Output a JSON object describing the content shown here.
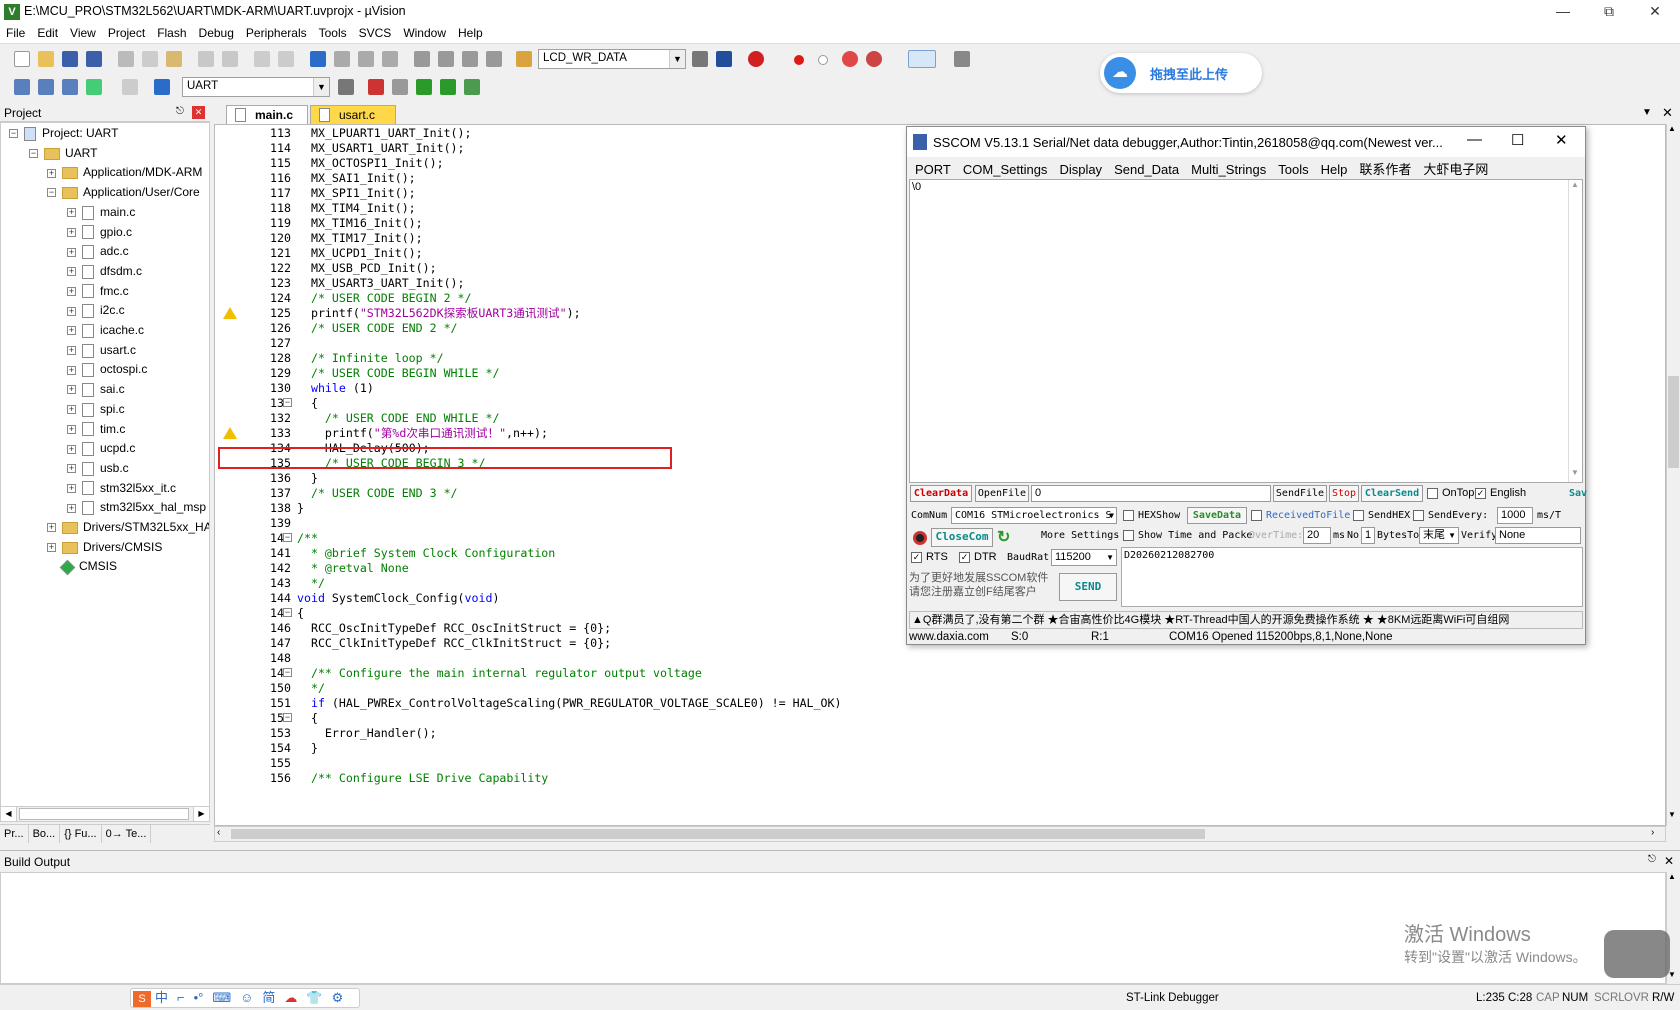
{
  "window": {
    "title": "E:\\MCU_PRO\\STM32L562\\UART\\MDK-ARM\\UART.uvprojx - µVision",
    "icon": "V"
  },
  "menu": [
    "File",
    "Edit",
    "View",
    "Project",
    "Flash",
    "Debug",
    "Peripherals",
    "Tools",
    "SVCS",
    "Window",
    "Help"
  ],
  "toolbar": {
    "function_combo": "LCD_WR_DATA",
    "target_combo": "UART"
  },
  "upload_badge": "拖拽至此上传",
  "project_panel": {
    "title": "Project",
    "items": [
      {
        "label": "Project: UART",
        "indent": 0,
        "type": "root"
      },
      {
        "label": "UART",
        "indent": 1,
        "type": "folder"
      },
      {
        "label": "Application/MDK-ARM",
        "indent": 2,
        "type": "folder"
      },
      {
        "label": "Application/User/Core",
        "indent": 2,
        "type": "folder"
      },
      {
        "label": "main.c",
        "indent": 3,
        "type": "file"
      },
      {
        "label": "gpio.c",
        "indent": 3,
        "type": "file"
      },
      {
        "label": "adc.c",
        "indent": 3,
        "type": "file"
      },
      {
        "label": "dfsdm.c",
        "indent": 3,
        "type": "file"
      },
      {
        "label": "fmc.c",
        "indent": 3,
        "type": "file"
      },
      {
        "label": "i2c.c",
        "indent": 3,
        "type": "file"
      },
      {
        "label": "icache.c",
        "indent": 3,
        "type": "file"
      },
      {
        "label": "usart.c",
        "indent": 3,
        "type": "file"
      },
      {
        "label": "octospi.c",
        "indent": 3,
        "type": "file"
      },
      {
        "label": "sai.c",
        "indent": 3,
        "type": "file"
      },
      {
        "label": "spi.c",
        "indent": 3,
        "type": "file"
      },
      {
        "label": "tim.c",
        "indent": 3,
        "type": "file"
      },
      {
        "label": "ucpd.c",
        "indent": 3,
        "type": "file"
      },
      {
        "label": "usb.c",
        "indent": 3,
        "type": "file"
      },
      {
        "label": "stm32l5xx_it.c",
        "indent": 3,
        "type": "file"
      },
      {
        "label": "stm32l5xx_hal_msp",
        "indent": 3,
        "type": "file"
      },
      {
        "label": "Drivers/STM32L5xx_HA",
        "indent": 2,
        "type": "folder"
      },
      {
        "label": "Drivers/CMSIS",
        "indent": 2,
        "type": "folder"
      },
      {
        "label": "CMSIS",
        "indent": 2,
        "type": "gem"
      }
    ],
    "bottom_tabs": [
      "Pr...",
      "Bo...",
      "{} Fu...",
      "0→ Te..."
    ]
  },
  "editor": {
    "tabs": [
      {
        "label": "main.c",
        "active": true
      },
      {
        "label": "usart.c",
        "active": false
      }
    ],
    "lines": [
      {
        "n": "113",
        "text": "  MX_LPUART1_UART_Init();",
        "cls": ""
      },
      {
        "n": "114",
        "text": "  MX_USART1_UART_Init();",
        "cls": ""
      },
      {
        "n": "115",
        "text": "  MX_OCTOSPI1_Init();",
        "cls": ""
      },
      {
        "n": "116",
        "text": "  MX_SAI1_Init();",
        "cls": ""
      },
      {
        "n": "117",
        "text": "  MX_SPI1_Init();",
        "cls": ""
      },
      {
        "n": "118",
        "text": "  MX_TIM4_Init();",
        "cls": ""
      },
      {
        "n": "119",
        "text": "  MX_TIM16_Init();",
        "cls": ""
      },
      {
        "n": "120",
        "text": "  MX_TIM17_Init();",
        "cls": ""
      },
      {
        "n": "121",
        "text": "  MX_UCPD1_Init();",
        "cls": ""
      },
      {
        "n": "122",
        "text": "  MX_USB_PCD_Init();",
        "cls": ""
      },
      {
        "n": "123",
        "text": "  MX_USART3_UART_Init();",
        "cls": ""
      },
      {
        "n": "124",
        "text": "  /* USER CODE BEGIN 2 */",
        "cls": "c1"
      },
      {
        "n": "125",
        "text": "  printf(\"STM32L562DK探索板UART3通讯测试\");",
        "cls": "pf",
        "warn": true
      },
      {
        "n": "126",
        "text": "  /* USER CODE END 2 */",
        "cls": "c1"
      },
      {
        "n": "127",
        "text": "",
        "cls": ""
      },
      {
        "n": "128",
        "text": "  /* Infinite loop */",
        "cls": "c1"
      },
      {
        "n": "129",
        "text": "  /* USER CODE BEGIN WHILE */",
        "cls": "c1"
      },
      {
        "n": "130",
        "text": "  while (1)",
        "cls": "wh"
      },
      {
        "n": "131",
        "text": "  {",
        "cls": "",
        "fold": true
      },
      {
        "n": "132",
        "text": "    /* USER CODE END WHILE */",
        "cls": "c1"
      },
      {
        "n": "133",
        "text": "    printf(\"第%d次串口通讯测试！\",n++);",
        "cls": "pf2",
        "warn": true
      },
      {
        "n": "134",
        "text": "    HAL_Delay(500);",
        "cls": ""
      },
      {
        "n": "135",
        "text": "    /* USER CODE BEGIN 3 */",
        "cls": "c1"
      },
      {
        "n": "136",
        "text": "  }",
        "cls": ""
      },
      {
        "n": "137",
        "text": "  /* USER CODE END 3 */",
        "cls": "c1"
      },
      {
        "n": "138",
        "text": "}",
        "cls": ""
      },
      {
        "n": "139",
        "text": "",
        "cls": ""
      },
      {
        "n": "140",
        "text": "/**",
        "cls": "c1",
        "fold": true
      },
      {
        "n": "141",
        "text": "  * @brief System Clock Configuration",
        "cls": "c1"
      },
      {
        "n": "142",
        "text": "  * @retval None",
        "cls": "c1"
      },
      {
        "n": "143",
        "text": "  */",
        "cls": "c1"
      },
      {
        "n": "144",
        "text": "void SystemClock_Config(void)",
        "cls": "fn"
      },
      {
        "n": "145",
        "text": "{",
        "cls": "",
        "fold": true
      },
      {
        "n": "146",
        "text": "  RCC_OscInitTypeDef RCC_OscInitStruct = {0};",
        "cls": ""
      },
      {
        "n": "147",
        "text": "  RCC_ClkInitTypeDef RCC_ClkInitStruct = {0};",
        "cls": ""
      },
      {
        "n": "148",
        "text": "",
        "cls": ""
      },
      {
        "n": "149",
        "text": "  /** Configure the main internal regulator output voltage",
        "cls": "c1",
        "fold": true
      },
      {
        "n": "150",
        "text": "  */",
        "cls": "c1"
      },
      {
        "n": "151",
        "text": "  if (HAL_PWREx_ControlVoltageScaling(PWR_REGULATOR_VOLTAGE_SCALE0) != HAL_OK)",
        "cls": "if"
      },
      {
        "n": "152",
        "text": "  {",
        "cls": "",
        "fold": true
      },
      {
        "n": "153",
        "text": "    Error_Handler();",
        "cls": ""
      },
      {
        "n": "154",
        "text": "  }",
        "cls": ""
      },
      {
        "n": "155",
        "text": "",
        "cls": ""
      },
      {
        "n": "156",
        "text": "  /** Configure LSE Drive Capability",
        "cls": "c1"
      }
    ]
  },
  "sscom": {
    "title": "SSCOM V5.13.1 Serial/Net data debugger,Author:Tintin,2618058@qq.com(Newest ver...",
    "menu": [
      "PORT",
      "COM_Settings",
      "Display",
      "Send_Data",
      "Multi_Strings",
      "Tools",
      "Help",
      "联系作者",
      "大虾电子网"
    ],
    "recv_text": "\\0",
    "clear_data": "ClearData",
    "open_file": "OpenFile",
    "file_input": "0",
    "send_file": "SendFile",
    "stop": "Stop",
    "clear_send": "ClearSend",
    "on_top": "OnTop",
    "english": "English",
    "save_short": "Sav",
    "com_num_label": "ComNum",
    "com_port": "COM16 STMicroelectronics S",
    "hex_show": "HEXShow",
    "save_data": "SaveData",
    "received_to_file": "ReceivedToFile",
    "send_hex": "SendHEX",
    "send_every": "SendEvery:",
    "send_every_val": "1000",
    "ms_t": "ms/T",
    "close_com": "CloseCom",
    "more_settings": "More Settings",
    "show_time": "Show Time and Packe",
    "overtime": "OverTime:",
    "overtime_val": "20",
    "ms": "ms",
    "no": "No",
    "no_val": "1",
    "bytes_to": "BytesTo",
    "bytes_to_val": "末尾",
    "verify": "Verify",
    "verify_val": "None",
    "rts": "RTS",
    "dtr": "DTR",
    "baud_label": "BaudRat",
    "baud": "115200",
    "send_text": "D20260212082700",
    "promo": "为了更好地发展SSCOM软件\n请您注册嘉立创F结尾客户",
    "send_btn": "SEND",
    "ticker": "▲Q群满员了,没有第二个群  ★合宙高性价比4G模块  ★RT-Thread中国人的开源免费操作系统  ★  ★8KM远距离WiFi可自组网",
    "status": [
      "www.daxia.com",
      "S:0",
      "R:1",
      "COM16 Opened  115200bps,8,1,None,None"
    ]
  },
  "build_output": {
    "title": "Build Output"
  },
  "status": {
    "debugger": "ST-Link Debugger",
    "pos": "L:235 C:28",
    "caps": "CAP",
    "num": "NUM",
    "scrl": "SCRL",
    "ovr": "OVR",
    "rw": "R/W"
  },
  "watermark": {
    "line1": "激活 Windows",
    "line2": "转到\"设置\"以激活 Windows。"
  },
  "ime": [
    "中",
    "⌐",
    "•°",
    "⌨",
    "☺",
    "简",
    "☁",
    "👕",
    "⚙"
  ]
}
